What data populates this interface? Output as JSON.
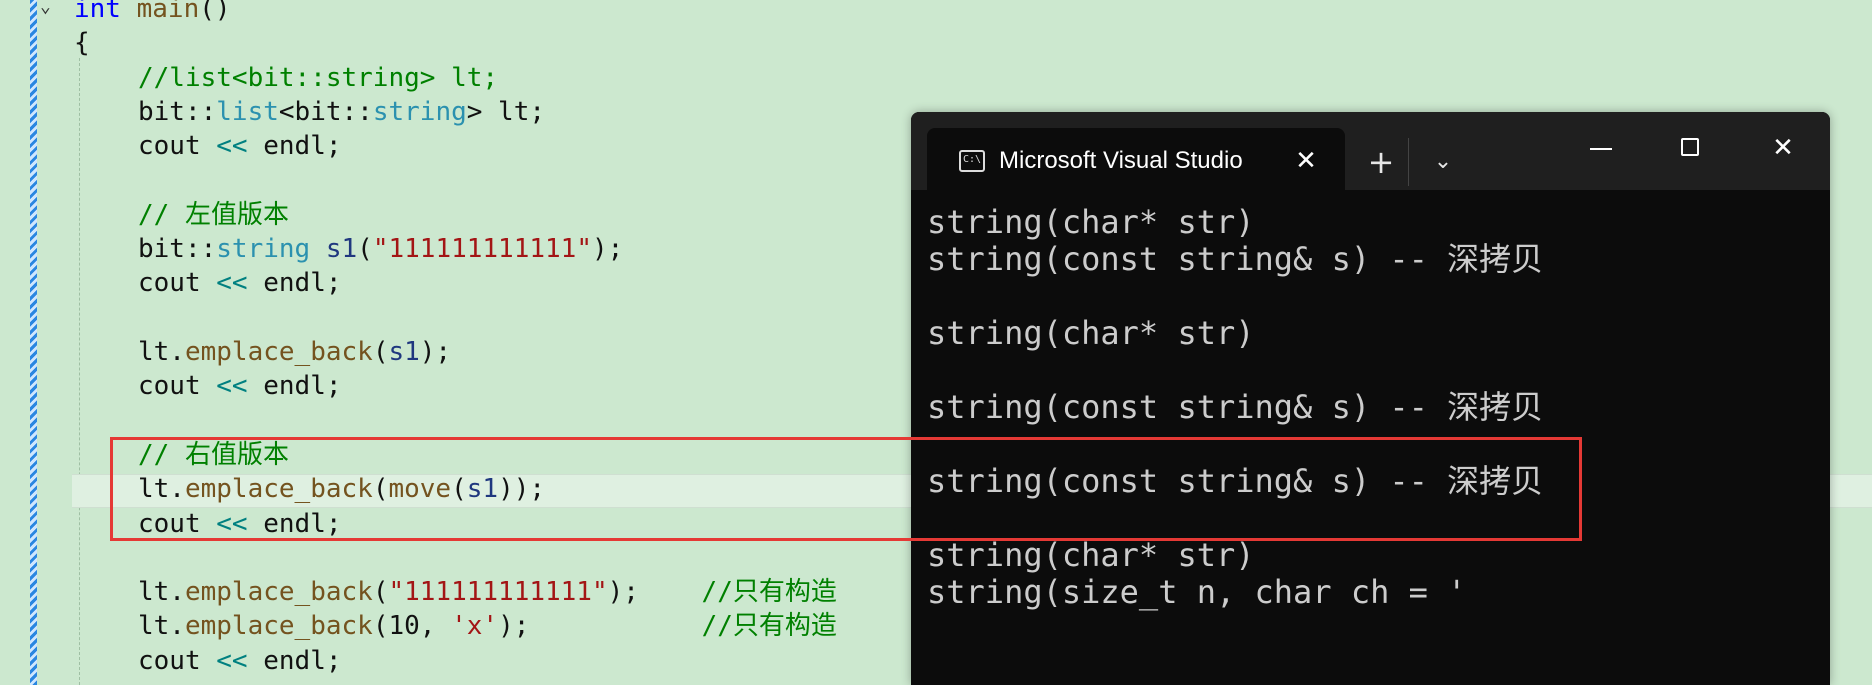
{
  "editor": {
    "lines": [
      [
        {
          "c": "kw",
          "t": "int "
        },
        {
          "c": "fn",
          "t": "main"
        },
        {
          "c": "plain",
          "t": "()"
        }
      ],
      [
        {
          "c": "plain",
          "t": "{"
        }
      ],
      [
        {
          "c": "cm",
          "t": "//list<bit::string> lt;"
        }
      ],
      [
        {
          "c": "plain",
          "t": "bit::"
        },
        {
          "c": "ty",
          "t": "list"
        },
        {
          "c": "plain",
          "t": "<bit::"
        },
        {
          "c": "ty",
          "t": "string"
        },
        {
          "c": "plain",
          "t": "> lt;"
        }
      ],
      [
        {
          "c": "plain",
          "t": "cout "
        },
        {
          "c": "op",
          "t": "<< "
        },
        {
          "c": "plain",
          "t": "endl;"
        }
      ],
      [],
      [
        {
          "c": "cm",
          "t": "// 左值版本"
        }
      ],
      [
        {
          "c": "plain",
          "t": "bit::"
        },
        {
          "c": "ty",
          "t": "string "
        },
        {
          "c": "vr",
          "t": "s1"
        },
        {
          "c": "plain",
          "t": "("
        },
        {
          "c": "st",
          "t": "\"111111111111\""
        },
        {
          "c": "plain",
          "t": ");"
        }
      ],
      [
        {
          "c": "plain",
          "t": "cout "
        },
        {
          "c": "op",
          "t": "<< "
        },
        {
          "c": "plain",
          "t": "endl;"
        }
      ],
      [],
      [
        {
          "c": "plain",
          "t": "lt."
        },
        {
          "c": "fn",
          "t": "emplace_back"
        },
        {
          "c": "plain",
          "t": "("
        },
        {
          "c": "vr",
          "t": "s1"
        },
        {
          "c": "plain",
          "t": ");"
        }
      ],
      [
        {
          "c": "plain",
          "t": "cout "
        },
        {
          "c": "op",
          "t": "<< "
        },
        {
          "c": "plain",
          "t": "endl;"
        }
      ],
      [],
      [
        {
          "c": "cm",
          "t": "// 右值版本"
        }
      ],
      [
        {
          "c": "plain",
          "t": "lt."
        },
        {
          "c": "fn",
          "t": "emplace_back"
        },
        {
          "c": "plain",
          "t": "("
        },
        {
          "c": "fn",
          "t": "move"
        },
        {
          "c": "plain",
          "t": "("
        },
        {
          "c": "vr",
          "t": "s1"
        },
        {
          "c": "plain",
          "t": "));"
        }
      ],
      [
        {
          "c": "plain",
          "t": "cout "
        },
        {
          "c": "op",
          "t": "<< "
        },
        {
          "c": "plain",
          "t": "endl;"
        }
      ],
      [],
      [
        {
          "c": "plain",
          "t": "lt."
        },
        {
          "c": "fn",
          "t": "emplace_back"
        },
        {
          "c": "plain",
          "t": "("
        },
        {
          "c": "st",
          "t": "\"111111111111\""
        },
        {
          "c": "plain",
          "t": ");    "
        },
        {
          "c": "cm",
          "t": "//只有构造"
        }
      ],
      [
        {
          "c": "plain",
          "t": "lt."
        },
        {
          "c": "fn",
          "t": "emplace_back"
        },
        {
          "c": "plain",
          "t": "(10, "
        },
        {
          "c": "st",
          "t": "'x'"
        },
        {
          "c": "plain",
          "t": ");           "
        },
        {
          "c": "cm",
          "t": "//只有构造"
        }
      ],
      [
        {
          "c": "plain",
          "t": "cout "
        },
        {
          "c": "op",
          "t": "<< "
        },
        {
          "c": "plain",
          "t": "endl;"
        }
      ]
    ]
  },
  "terminal": {
    "tab_title": "Microsoft Visual Studio",
    "tab_icon_text": "C:\\",
    "close_glyph": "✕",
    "new_tab_glyph": "+",
    "dropdown_glyph": "⌄",
    "window_close_glyph": "✕",
    "lines": [
      "string(char* str)",
      "string(const string& s) -- 深拷贝",
      "",
      "string(char* str)",
      "",
      "string(const string& s) -- 深拷贝",
      "",
      "string(const string& s) -- 深拷贝",
      "",
      "string(char* str)",
      "string(size_t n, char ch = '"
    ]
  },
  "colors": {
    "editor_background": "#cce8cf",
    "keyword": "#0000ff",
    "comment": "#008000",
    "type": "#2b91af",
    "function": "#74531f",
    "string": "#a31515",
    "highlight_box": "#e53935",
    "terminal_background": "#0c0c0c"
  }
}
